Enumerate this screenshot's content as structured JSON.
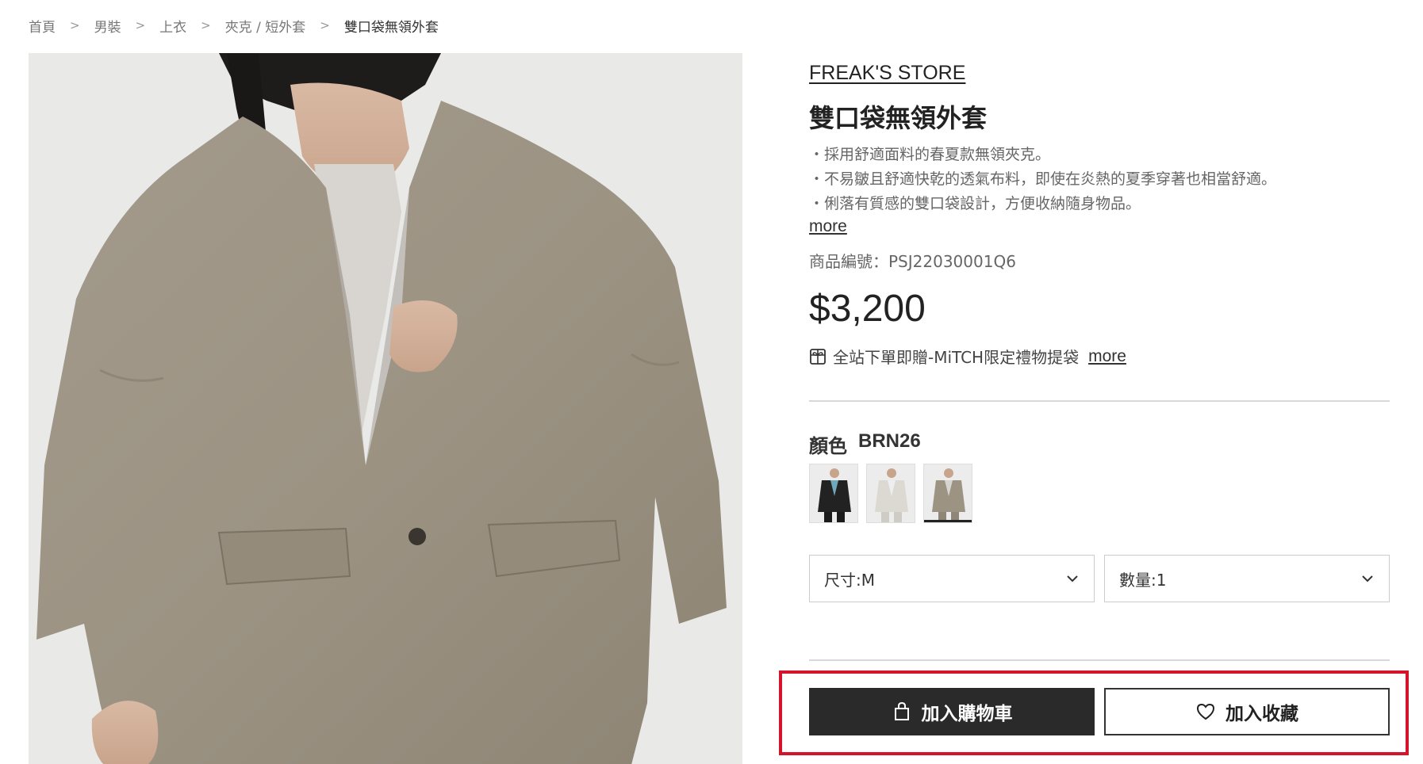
{
  "breadcrumb": {
    "items": [
      "首頁",
      "男裝",
      "上衣",
      "夾克 / 短外套"
    ],
    "current": "雙口袋無領外套"
  },
  "product": {
    "brand": "FREAK'S STORE",
    "title": "雙口袋無領外套",
    "description": [
      "・採用舒適面料的春夏款無領夾克。",
      "・不易皺且舒適快乾的透氣布料，即使在炎熱的夏季穿著也相當舒適。",
      "・俐落有質感的雙口袋設計，方便收納隨身物品。"
    ],
    "more_label": "more",
    "sku": "商品編號：PSJ22030001Q6",
    "price": "$3,200",
    "promo_text": "全站下單即贈-MiTCH限定禮物提袋",
    "promo_more": "more"
  },
  "options": {
    "color_label": "顏色",
    "color_value": "BRN26",
    "swatches": [
      "black",
      "white",
      "brown"
    ],
    "selected_swatch": 2,
    "size_select": "尺寸:M",
    "qty_select": "數量:1"
  },
  "actions": {
    "add_to_cart": "加入購物車",
    "add_to_favorites": "加入收藏"
  },
  "colors": {
    "highlight": "#d3142a",
    "cart_button": "#2a2a2a"
  }
}
